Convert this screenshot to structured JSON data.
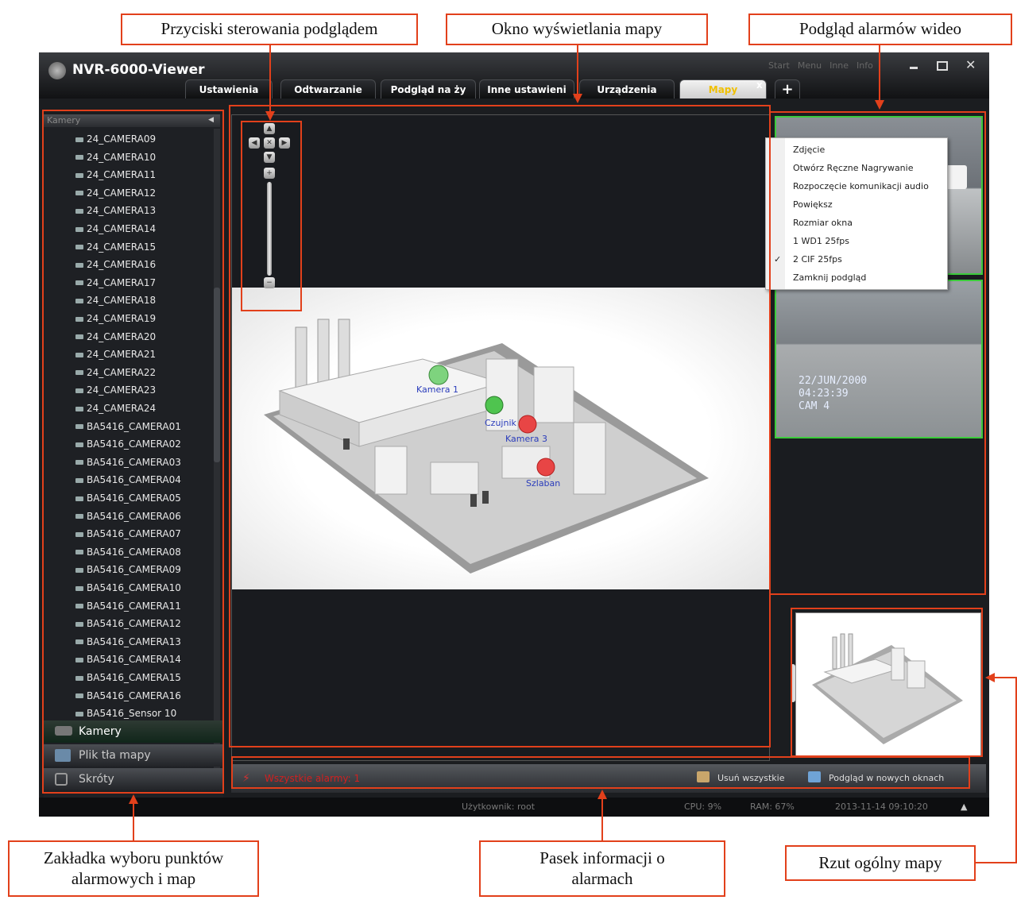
{
  "callouts": {
    "controls": "Przyciski sterowania podglądem",
    "map_window": "Okno wyświetlania mapy",
    "video_alarms": "Podgląd alarmów wideo",
    "tab_selection_line1": "Zakładka wyboru punktów",
    "tab_selection_line2": "alarmowych i map",
    "info_bar_line1": "Pasek informacji o",
    "info_bar_line2": "alarmach",
    "overview": "Rzut ogólny mapy"
  },
  "app": {
    "title": "NVR-6000-Viewer",
    "top_menu": [
      "Start",
      "Menu",
      "Inne",
      "Info"
    ],
    "tabs": [
      "Ustawienia",
      "Odtwarzanie",
      "Podgląd na ży",
      "Inne ustawieni",
      "Urządzenia",
      "Mapy"
    ],
    "add_tab": "+",
    "close_tab": "x"
  },
  "sidebar": {
    "header": "Kamery",
    "cameras": [
      "24_CAMERA09",
      "24_CAMERA10",
      "24_CAMERA11",
      "24_CAMERA12",
      "24_CAMERA13",
      "24_CAMERA14",
      "24_CAMERA15",
      "24_CAMERA16",
      "24_CAMERA17",
      "24_CAMERA18",
      "24_CAMERA19",
      "24_CAMERA20",
      "24_CAMERA21",
      "24_CAMERA22",
      "24_CAMERA23",
      "24_CAMERA24",
      "BA5416_CAMERA01",
      "BA5416_CAMERA02",
      "BA5416_CAMERA03",
      "BA5416_CAMERA04",
      "BA5416_CAMERA05",
      "BA5416_CAMERA06",
      "BA5416_CAMERA07",
      "BA5416_CAMERA08",
      "BA5416_CAMERA09",
      "BA5416_CAMERA10",
      "BA5416_CAMERA11",
      "BA5416_CAMERA12",
      "BA5416_CAMERA13",
      "BA5416_CAMERA14",
      "BA5416_CAMERA15",
      "BA5416_CAMERA16",
      "BA5416_Sensor 10"
    ],
    "bottom_tabs": [
      "Kamery",
      "Plik tła mapy",
      "Skróty"
    ]
  },
  "map": {
    "markers": [
      "Kamera 1",
      "Kamera 3",
      "Czujnik",
      "Szlaban"
    ]
  },
  "context_menu": {
    "items": [
      "Zdjęcie",
      "Otwórz Ręczne Nagrywanie",
      "Rozpoczęcie komunikacji audio",
      "Powiększ",
      "Rozmiar okna",
      "1 WD1 25fps",
      "2 CIF 25fps",
      "Zamknij podgląd"
    ],
    "checked": "2 CIF 25fps"
  },
  "video": {
    "osd_date": "22/JUN/2000",
    "osd_time": "04:23:39",
    "osd_cam": "CAM 4"
  },
  "infobar": {
    "alarm_text": "Wszystkie alarmy: 1",
    "delete_all": "Usuń wszystkie",
    "preview_new": "Podgląd w nowych oknach"
  },
  "status": {
    "user": "Użytkownik: root",
    "cpu": "CPU: 9%",
    "ram": "RAM: 67%",
    "datetime": "2013-11-14 09:10:20"
  }
}
